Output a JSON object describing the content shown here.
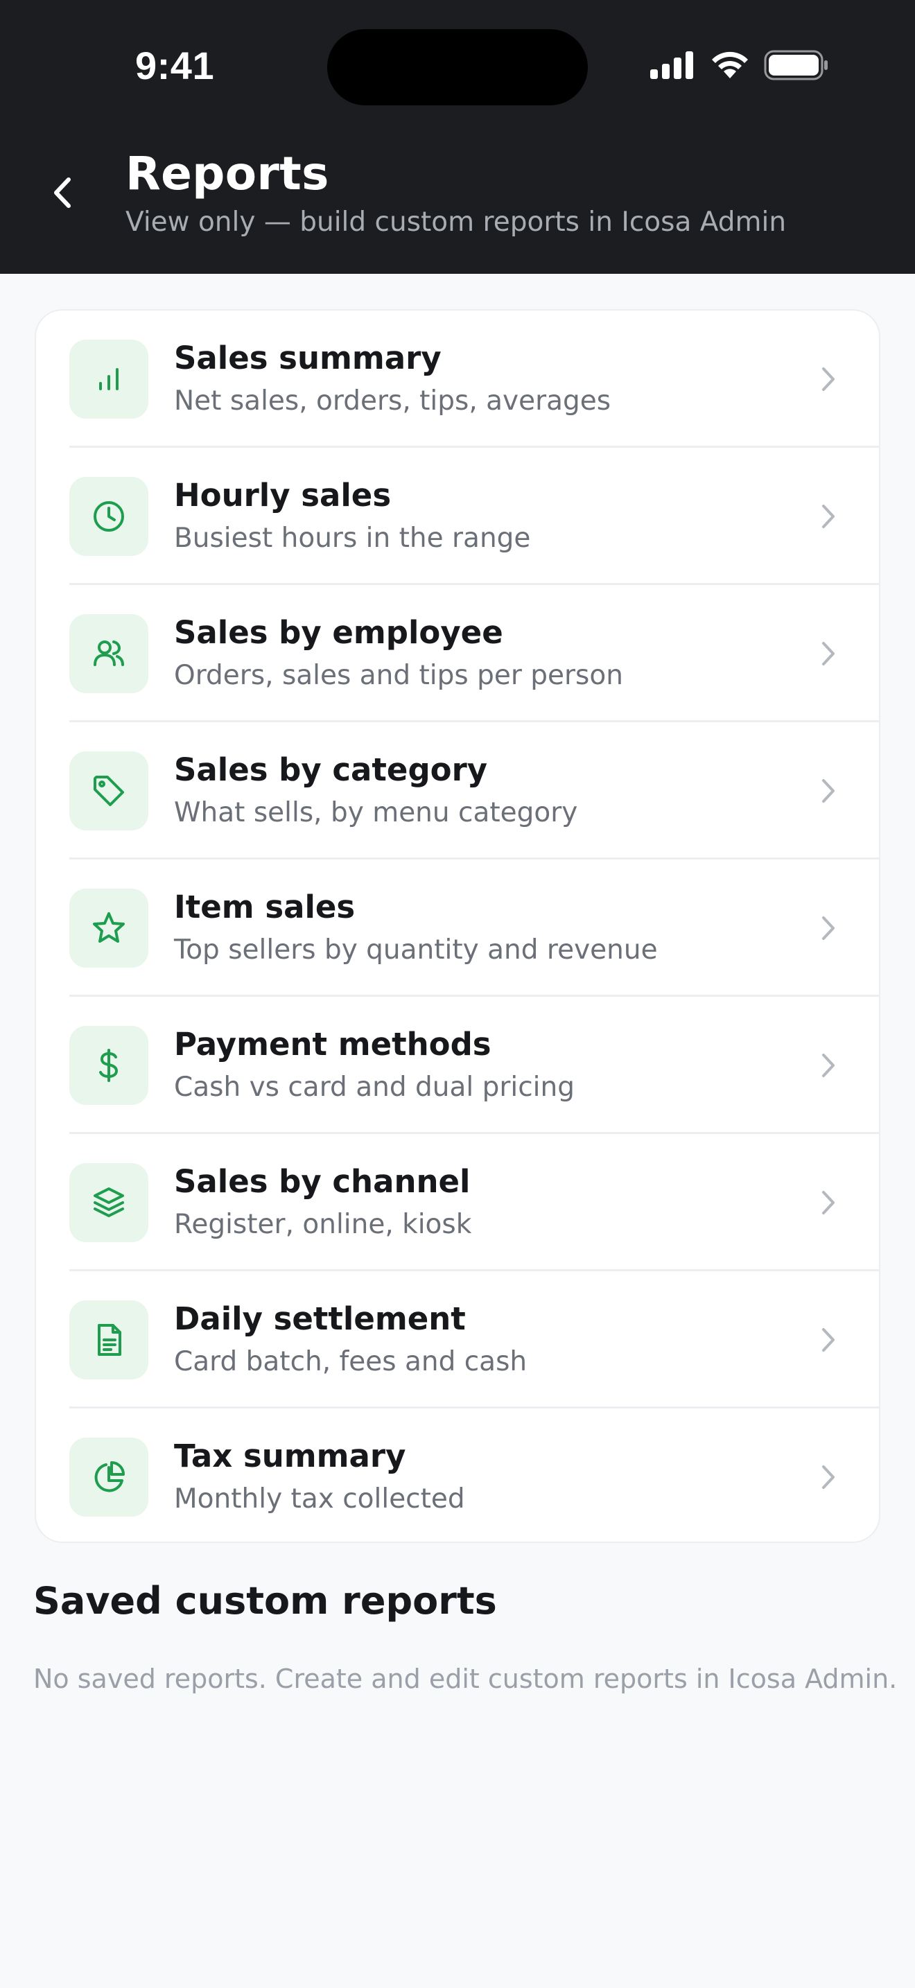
{
  "status_bar": {
    "time": "9:41",
    "icons": [
      "cellular-signal-icon",
      "wifi-icon",
      "battery-icon"
    ]
  },
  "header": {
    "back_icon": "chevron-left-icon",
    "title": "Reports",
    "subtitle": "View only — build custom reports in Icosa Admin"
  },
  "colors": {
    "header_bg": "#1c1d20",
    "accent_green": "#1f9d4e",
    "icon_tile_bg": "#e8f6ec",
    "page_bg": "#f8f9fb"
  },
  "reports": [
    {
      "title": "Sales summary",
      "desc": "Net sales, orders, tips, averages",
      "icon": "bar-chart-icon"
    },
    {
      "title": "Hourly sales",
      "desc": "Busiest hours in the range",
      "icon": "clock-icon"
    },
    {
      "title": "Sales by employee",
      "desc": "Orders, sales and tips per person",
      "icon": "users-icon"
    },
    {
      "title": "Sales by category",
      "desc": "What sells, by menu category",
      "icon": "tag-icon"
    },
    {
      "title": "Item sales",
      "desc": "Top sellers by quantity and revenue",
      "icon": "star-icon"
    },
    {
      "title": "Payment methods",
      "desc": "Cash vs card and dual pricing",
      "icon": "dollar-icon"
    },
    {
      "title": "Sales by channel",
      "desc": "Register, online, kiosk",
      "icon": "layers-icon"
    },
    {
      "title": "Daily settlement",
      "desc": "Card batch, fees and cash",
      "icon": "document-icon"
    },
    {
      "title": "Tax summary",
      "desc": "Monthly tax collected",
      "icon": "pie-chart-icon"
    }
  ],
  "saved_section": {
    "title": "Saved custom reports",
    "empty_text": "No saved reports. Create and edit custom reports in Icosa Admin."
  }
}
